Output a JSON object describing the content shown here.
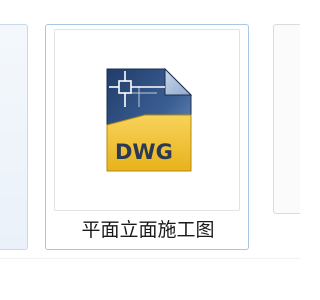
{
  "file": {
    "name": "平面立面施工图",
    "type_badge": "DWG",
    "icon": "dwg-file-icon",
    "selected": true
  },
  "colors": {
    "selection_border": "#a8c6e6",
    "icon_blue_dark": "#1f3a66",
    "icon_blue_light": "#6f93c4",
    "icon_yellow": "#f2c230",
    "badge_text": "#2a3a55"
  }
}
